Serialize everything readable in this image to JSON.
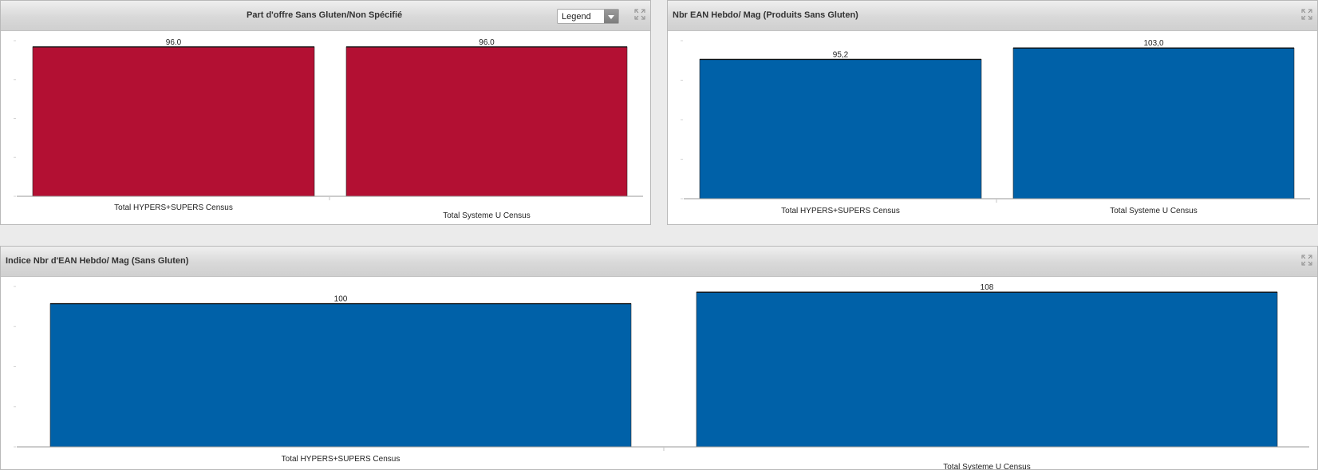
{
  "panels": [
    {
      "title": "Part d'offre   Sans Gluten/Non Spécifié",
      "legend_select": "Legend"
    },
    {
      "title": "Nbr EAN Hebdo/ Mag (Produits Sans Gluten)"
    },
    {
      "title": "Indice Nbr d'EAN Hebdo/ Mag (Sans Gluten)"
    }
  ],
  "chart_data": [
    {
      "type": "bar",
      "title": "Part d'offre   Sans Gluten/Non Spécifié",
      "categories": [
        "Total HYPERS+SUPERS Census",
        "Total Systeme U Census"
      ],
      "values": [
        96.0,
        96.0
      ],
      "value_labels": [
        "96.0",
        "96.0"
      ],
      "ylim": [
        0,
        100
      ],
      "bar_color": "#b31033",
      "legend": "collapsed dropdown",
      "grid": false
    },
    {
      "type": "bar",
      "title": "Nbr EAN Hebdo/ Mag (Produits Sans Gluten)",
      "categories": [
        "Total HYPERS+SUPERS Census",
        "Total Systeme U Census"
      ],
      "values": [
        95.2,
        103.0
      ],
      "value_labels": [
        "95,2",
        "103,0"
      ],
      "ylim": [
        0,
        108
      ],
      "bar_color": "#0061a8",
      "grid": false
    },
    {
      "type": "bar",
      "title": "Indice Nbr d'EAN Hebdo/ Mag (Sans Gluten)",
      "categories": [
        "Total HYPERS+SUPERS Census",
        "Total Systeme U Census"
      ],
      "values": [
        100,
        108
      ],
      "value_labels": [
        "100",
        "108"
      ],
      "ylim": [
        0,
        112
      ],
      "bar_color": "#0061a8",
      "grid": false
    }
  ]
}
